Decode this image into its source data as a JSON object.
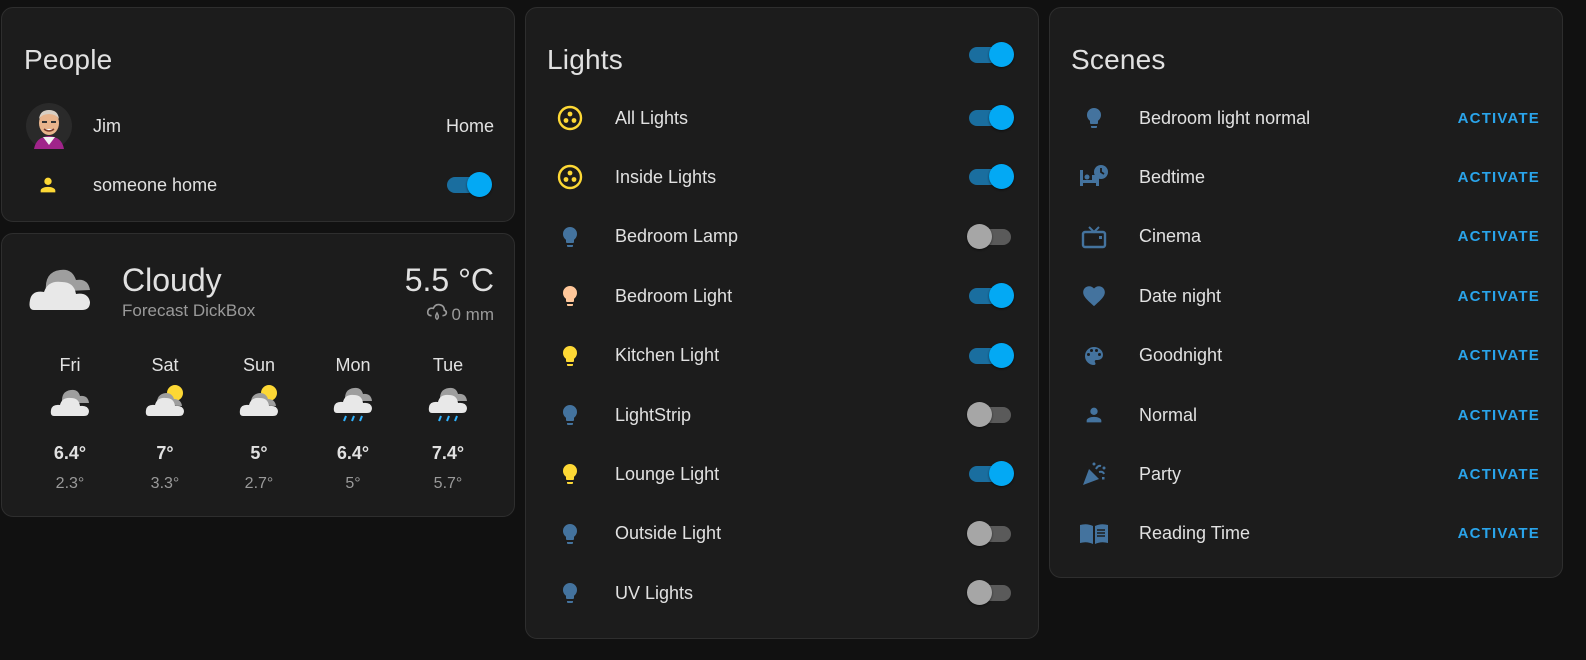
{
  "colors": {
    "accent": "#03a9f4",
    "icon_blue": "#44739e",
    "icon_yellow": "#fdd835",
    "icon_peach": "#ffc79a",
    "activate": "#2aa4ea"
  },
  "people": {
    "title": "People",
    "rows": [
      {
        "name": "Jim",
        "state": "Home",
        "icon": "avatar"
      },
      {
        "name": "someone home",
        "icon": "person-icon",
        "toggle": true
      }
    ]
  },
  "weather": {
    "condition": "Cloudy",
    "source": "Forecast DickBox",
    "temperature": "5.5 °C",
    "precipitation": "0 mm",
    "forecast": [
      {
        "day": "Fri",
        "icon": "cloudy-icon",
        "high": "6.4°",
        "low": "2.3°"
      },
      {
        "day": "Sat",
        "icon": "partly-cloudy-icon",
        "high": "7°",
        "low": "3.3°"
      },
      {
        "day": "Sun",
        "icon": "partly-cloudy-icon",
        "high": "5°",
        "low": "2.7°"
      },
      {
        "day": "Mon",
        "icon": "rainy-icon",
        "high": "6.4°",
        "low": "5°"
      },
      {
        "day": "Tue",
        "icon": "rainy-icon",
        "high": "7.4°",
        "low": "5.7°"
      }
    ]
  },
  "lights": {
    "title": "Lights",
    "header_toggle": true,
    "items": [
      {
        "label": "All Lights",
        "icon": "group-icon",
        "on": true,
        "color": "#fdd835"
      },
      {
        "label": "Inside Lights",
        "icon": "group-icon",
        "on": true,
        "color": "#fdd835"
      },
      {
        "label": "Bedroom Lamp",
        "icon": "bulb-icon",
        "on": false,
        "color": "#44739e"
      },
      {
        "label": "Bedroom Light",
        "icon": "bulb-icon",
        "on": true,
        "color": "#ffc79a"
      },
      {
        "label": "Kitchen Light",
        "icon": "bulb-icon",
        "on": true,
        "color": "#fdd835"
      },
      {
        "label": "LightStrip",
        "icon": "bulb-icon",
        "on": false,
        "color": "#44739e"
      },
      {
        "label": "Lounge Light",
        "icon": "bulb-icon",
        "on": true,
        "color": "#fdd835"
      },
      {
        "label": "Outside Light",
        "icon": "bulb-icon",
        "on": false,
        "color": "#44739e"
      },
      {
        "label": "UV Lights",
        "icon": "bulb-icon",
        "on": false,
        "color": "#44739e"
      }
    ]
  },
  "scenes": {
    "title": "Scenes",
    "action_label": "ACTIVATE",
    "items": [
      {
        "label": "Bedroom light normal",
        "icon": "bulb-icon"
      },
      {
        "label": "Bedtime",
        "icon": "bed-clock-icon"
      },
      {
        "label": "Cinema",
        "icon": "tv-icon"
      },
      {
        "label": "Date night",
        "icon": "heart-icon"
      },
      {
        "label": "Goodnight",
        "icon": "palette-icon"
      },
      {
        "label": "Normal",
        "icon": "person-icon"
      },
      {
        "label": "Party",
        "icon": "party-popper-icon"
      },
      {
        "label": "Reading Time",
        "icon": "book-open-icon"
      }
    ]
  }
}
